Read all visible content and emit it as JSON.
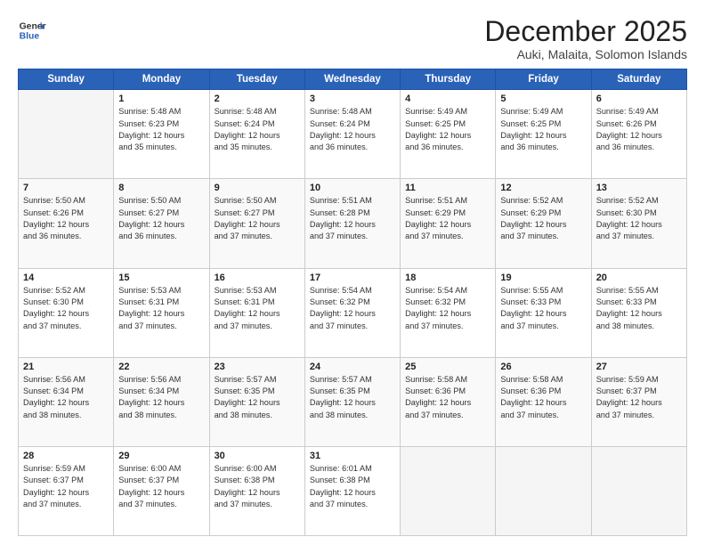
{
  "header": {
    "logo_line1": "General",
    "logo_line2": "Blue",
    "title": "December 2025",
    "subtitle": "Auki, Malaita, Solomon Islands"
  },
  "days_of_week": [
    "Sunday",
    "Monday",
    "Tuesday",
    "Wednesday",
    "Thursday",
    "Friday",
    "Saturday"
  ],
  "weeks": [
    [
      {
        "day": "",
        "info": ""
      },
      {
        "day": "1",
        "info": "Sunrise: 5:48 AM\nSunset: 6:23 PM\nDaylight: 12 hours\nand 35 minutes."
      },
      {
        "day": "2",
        "info": "Sunrise: 5:48 AM\nSunset: 6:24 PM\nDaylight: 12 hours\nand 35 minutes."
      },
      {
        "day": "3",
        "info": "Sunrise: 5:48 AM\nSunset: 6:24 PM\nDaylight: 12 hours\nand 36 minutes."
      },
      {
        "day": "4",
        "info": "Sunrise: 5:49 AM\nSunset: 6:25 PM\nDaylight: 12 hours\nand 36 minutes."
      },
      {
        "day": "5",
        "info": "Sunrise: 5:49 AM\nSunset: 6:25 PM\nDaylight: 12 hours\nand 36 minutes."
      },
      {
        "day": "6",
        "info": "Sunrise: 5:49 AM\nSunset: 6:26 PM\nDaylight: 12 hours\nand 36 minutes."
      }
    ],
    [
      {
        "day": "7",
        "info": "Sunrise: 5:50 AM\nSunset: 6:26 PM\nDaylight: 12 hours\nand 36 minutes."
      },
      {
        "day": "8",
        "info": "Sunrise: 5:50 AM\nSunset: 6:27 PM\nDaylight: 12 hours\nand 36 minutes."
      },
      {
        "day": "9",
        "info": "Sunrise: 5:50 AM\nSunset: 6:27 PM\nDaylight: 12 hours\nand 37 minutes."
      },
      {
        "day": "10",
        "info": "Sunrise: 5:51 AM\nSunset: 6:28 PM\nDaylight: 12 hours\nand 37 minutes."
      },
      {
        "day": "11",
        "info": "Sunrise: 5:51 AM\nSunset: 6:29 PM\nDaylight: 12 hours\nand 37 minutes."
      },
      {
        "day": "12",
        "info": "Sunrise: 5:52 AM\nSunset: 6:29 PM\nDaylight: 12 hours\nand 37 minutes."
      },
      {
        "day": "13",
        "info": "Sunrise: 5:52 AM\nSunset: 6:30 PM\nDaylight: 12 hours\nand 37 minutes."
      }
    ],
    [
      {
        "day": "14",
        "info": "Sunrise: 5:52 AM\nSunset: 6:30 PM\nDaylight: 12 hours\nand 37 minutes."
      },
      {
        "day": "15",
        "info": "Sunrise: 5:53 AM\nSunset: 6:31 PM\nDaylight: 12 hours\nand 37 minutes."
      },
      {
        "day": "16",
        "info": "Sunrise: 5:53 AM\nSunset: 6:31 PM\nDaylight: 12 hours\nand 37 minutes."
      },
      {
        "day": "17",
        "info": "Sunrise: 5:54 AM\nSunset: 6:32 PM\nDaylight: 12 hours\nand 37 minutes."
      },
      {
        "day": "18",
        "info": "Sunrise: 5:54 AM\nSunset: 6:32 PM\nDaylight: 12 hours\nand 37 minutes."
      },
      {
        "day": "19",
        "info": "Sunrise: 5:55 AM\nSunset: 6:33 PM\nDaylight: 12 hours\nand 37 minutes."
      },
      {
        "day": "20",
        "info": "Sunrise: 5:55 AM\nSunset: 6:33 PM\nDaylight: 12 hours\nand 38 minutes."
      }
    ],
    [
      {
        "day": "21",
        "info": "Sunrise: 5:56 AM\nSunset: 6:34 PM\nDaylight: 12 hours\nand 38 minutes."
      },
      {
        "day": "22",
        "info": "Sunrise: 5:56 AM\nSunset: 6:34 PM\nDaylight: 12 hours\nand 38 minutes."
      },
      {
        "day": "23",
        "info": "Sunrise: 5:57 AM\nSunset: 6:35 PM\nDaylight: 12 hours\nand 38 minutes."
      },
      {
        "day": "24",
        "info": "Sunrise: 5:57 AM\nSunset: 6:35 PM\nDaylight: 12 hours\nand 38 minutes."
      },
      {
        "day": "25",
        "info": "Sunrise: 5:58 AM\nSunset: 6:36 PM\nDaylight: 12 hours\nand 37 minutes."
      },
      {
        "day": "26",
        "info": "Sunrise: 5:58 AM\nSunset: 6:36 PM\nDaylight: 12 hours\nand 37 minutes."
      },
      {
        "day": "27",
        "info": "Sunrise: 5:59 AM\nSunset: 6:37 PM\nDaylight: 12 hours\nand 37 minutes."
      }
    ],
    [
      {
        "day": "28",
        "info": "Sunrise: 5:59 AM\nSunset: 6:37 PM\nDaylight: 12 hours\nand 37 minutes."
      },
      {
        "day": "29",
        "info": "Sunrise: 6:00 AM\nSunset: 6:37 PM\nDaylight: 12 hours\nand 37 minutes."
      },
      {
        "day": "30",
        "info": "Sunrise: 6:00 AM\nSunset: 6:38 PM\nDaylight: 12 hours\nand 37 minutes."
      },
      {
        "day": "31",
        "info": "Sunrise: 6:01 AM\nSunset: 6:38 PM\nDaylight: 12 hours\nand 37 minutes."
      },
      {
        "day": "",
        "info": ""
      },
      {
        "day": "",
        "info": ""
      },
      {
        "day": "",
        "info": ""
      }
    ]
  ]
}
